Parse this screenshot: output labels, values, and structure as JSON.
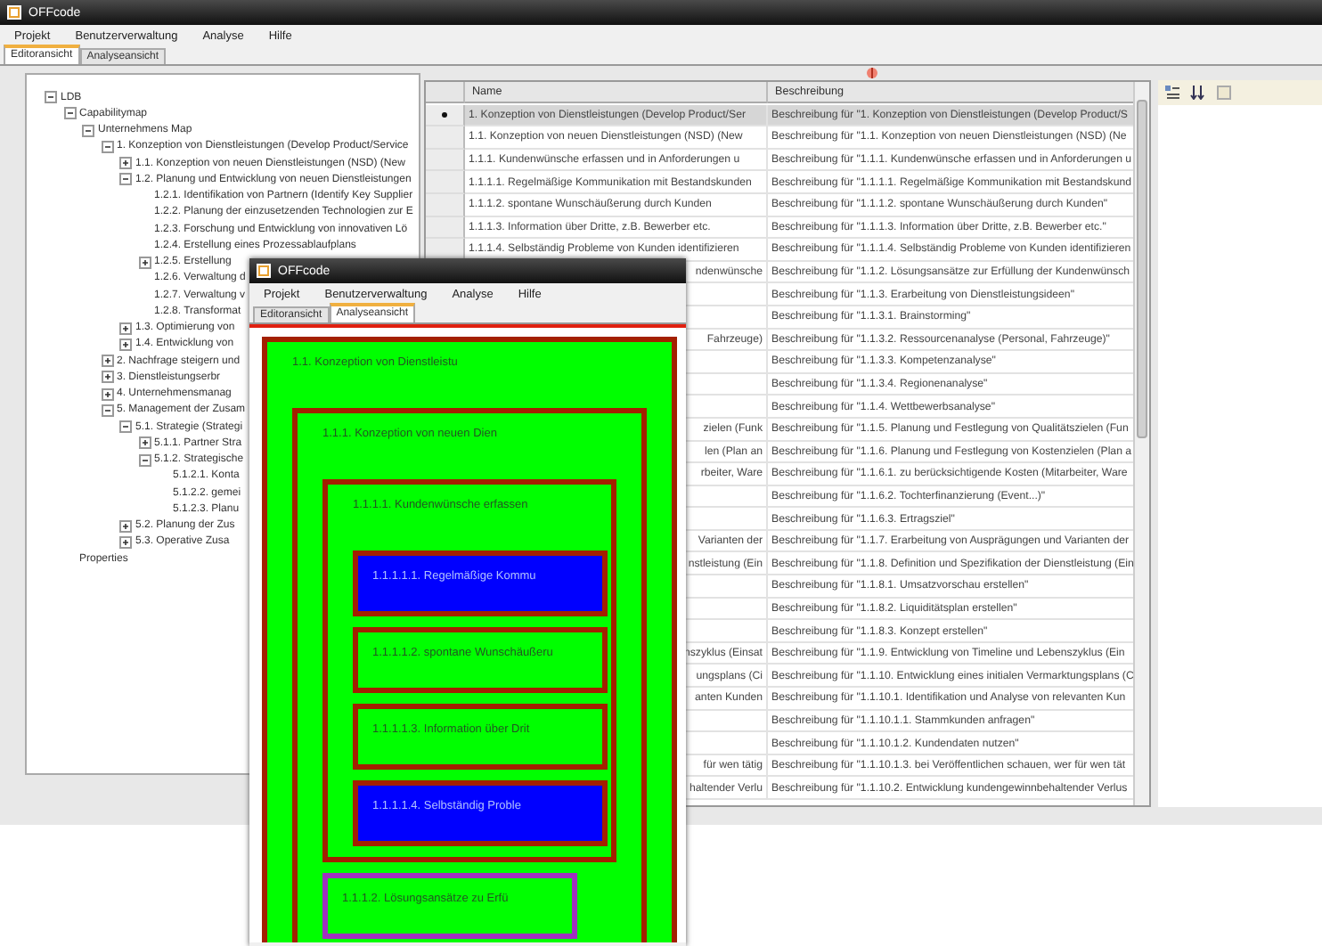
{
  "main_window": {
    "title": "OFFcode",
    "menu": [
      "Projekt",
      "Benutzerverwaltung",
      "Analyse",
      "Hilfe"
    ],
    "tabs": [
      {
        "label": "Editoransicht",
        "selected": true
      },
      {
        "label": "Analyseansicht",
        "selected": false
      }
    ],
    "tree": {
      "items": [
        {
          "label": "LDB",
          "expanded": true,
          "children": [
            {
              "label": "Capabilitymap",
              "expanded": true,
              "children": [
                {
                  "label": "Unternehmens Map",
                  "expanded": true,
                  "children": [
                    {
                      "label": "1. Konzeption von Dienstleistungen (Develop Product/Service",
                      "expanded": true,
                      "children": [
                        {
                          "label": "1.1. Konzeption von neuen Dienstleistungen (NSD) (New",
                          "expanded": false
                        },
                        {
                          "label": "1.2. Planung und Entwicklung von neuen Dienstleistungen",
                          "expanded": true,
                          "children": [
                            {
                              "label": "1.2.1. Identifikation von Partnern (Identify Key Supplier"
                            },
                            {
                              "label": "1.2.2. Planung der einzusetzenden Technologien zur E"
                            },
                            {
                              "label": "1.2.3. Forschung und Entwicklung von innovativen Lö"
                            },
                            {
                              "label": "1.2.4. Erstellung eines Prozessablaufplans"
                            },
                            {
                              "label": "1.2.5. Erstellung",
                              "expanded": false
                            },
                            {
                              "label": "1.2.6. Verwaltung d"
                            },
                            {
                              "label": "1.2.7. Verwaltung v"
                            },
                            {
                              "label": "1.2.8. Transformat"
                            }
                          ]
                        },
                        {
                          "label": "1.3. Optimierung von",
                          "expanded": false
                        },
                        {
                          "label": "1.4. Entwicklung von",
                          "expanded": false
                        }
                      ]
                    },
                    {
                      "label": "2. Nachfrage steigern und",
                      "expanded": false
                    },
                    {
                      "label": "3. Dienstleistungserbr",
                      "expanded": false
                    },
                    {
                      "label": "4. Unternehmensmanag",
                      "expanded": false
                    },
                    {
                      "label": "5. Management der Zusam",
                      "expanded": true,
                      "children": [
                        {
                          "label": "5.1. Strategie (Strategi",
                          "expanded": true,
                          "children": [
                            {
                              "label": "5.1.1. Partner Stra",
                              "expanded": false
                            },
                            {
                              "label": "5.1.2. Strategische",
                              "expanded": true,
                              "children": [
                                {
                                  "label": "5.1.2.1. Konta"
                                },
                                {
                                  "label": "5.1.2.2. gemei"
                                },
                                {
                                  "label": "5.1.2.3. Planu"
                                }
                              ]
                            }
                          ]
                        },
                        {
                          "label": "5.2. Planung der Zus",
                          "expanded": false
                        },
                        {
                          "label": "5.3. Operative Zusa",
                          "expanded": false
                        }
                      ]
                    }
                  ]
                }
              ]
            },
            {
              "label": "Properties"
            }
          ]
        }
      ]
    },
    "grid": {
      "columns": [
        "Name",
        "Beschreibung"
      ],
      "rows": [
        {
          "name": "1. Konzeption von Dienstleistungen (Develop Product/Ser",
          "description": "Beschreibung für \"1. Konzeption von Dienstleistungen (Develop Product/S",
          "selected": true
        },
        {
          "name": "1.1. Konzeption von neuen Dienstleistungen (NSD) (New",
          "description": "Beschreibung für \"1.1. Konzeption von neuen Dienstleistungen (NSD) (Ne",
          "selected": false
        },
        {
          "name": "1.1.1. Kundenwünsche erfassen und in Anforderungen u",
          "description": "Beschreibung für \"1.1.1. Kundenwünsche erfassen und in Anforderungen u",
          "selected": false
        },
        {
          "name": "1.1.1.1. Regelmäßige Kommunikation mit Bestandskunden",
          "description": "Beschreibung für \"1.1.1.1. Regelmäßige Kommunikation mit Bestandskund",
          "selected": false
        },
        {
          "name": "1.1.1.2. spontane Wunschäußerung durch Kunden",
          "description": "Beschreibung für \"1.1.1.2. spontane Wunschäußerung durch Kunden\"",
          "selected": false
        },
        {
          "name": "1.1.1.3. Information über Dritte, z.B. Bewerber etc.",
          "description": "Beschreibung für \"1.1.1.3. Information über Dritte, z.B. Bewerber etc.\"",
          "selected": false
        },
        {
          "name": "1.1.1.4. Selbständig Probleme von Kunden identifizieren",
          "description": "Beschreibung für \"1.1.1.4. Selbständig Probleme von Kunden identifizieren",
          "selected": false
        },
        {
          "name_tail": "ndenwünsche",
          "description": "Beschreibung für \"1.1.2. Lösungsansätze zur Erfüllung der Kundenwünsch",
          "selected": false
        },
        {
          "description": "Beschreibung für \"1.1.3. Erarbeitung von Dienstleistungsideen\"",
          "selected": false
        },
        {
          "description": "Beschreibung für \"1.1.3.1. Brainstorming\"",
          "selected": false
        },
        {
          "name_tail": "Fahrzeuge)",
          "description": "Beschreibung für \"1.1.3.2. Ressourcenanalyse (Personal, Fahrzeuge)\"",
          "selected": false
        },
        {
          "description": "Beschreibung für \"1.1.3.3. Kompetenzanalyse\"",
          "selected": false
        },
        {
          "description": "Beschreibung für \"1.1.3.4. Regionenanalyse\"",
          "selected": false
        },
        {
          "description": "Beschreibung für \"1.1.4. Wettbewerbsanalyse\"",
          "selected": false
        },
        {
          "name_tail": "zielen (Funk",
          "description": "Beschreibung für \"1.1.5. Planung und Festlegung von Qualitätszielen (Fun",
          "selected": false
        },
        {
          "name_tail": "len (Plan an",
          "description": "Beschreibung für \"1.1.6. Planung und Festlegung von Kostenzielen (Plan a",
          "selected": false
        },
        {
          "name_tail": "rbeiter, Ware",
          "description": "Beschreibung für \"1.1.6.1. zu berücksichtigende Kosten (Mitarbeiter, Ware",
          "selected": false
        },
        {
          "description": "Beschreibung für \"1.1.6.2. Tochterfinanzierung (Event...)\"",
          "selected": false
        },
        {
          "description": "Beschreibung für \"1.1.6.3. Ertragsziel\"",
          "selected": false
        },
        {
          "name_tail": "Varianten der",
          "description": "Beschreibung für \"1.1.7. Erarbeitung von Ausprägungen und Varianten der",
          "selected": false
        },
        {
          "name_tail": "nstleistung (Ein",
          "description": "Beschreibung für \"1.1.8. Definition und Spezifikation der Dienstleistung (Ein",
          "selected": false
        },
        {
          "description": "Beschreibung für \"1.1.8.1. Umsatzvorschau erstellen\"",
          "selected": false
        },
        {
          "description": "Beschreibung für \"1.1.8.2. Liquiditätsplan erstellen\"",
          "selected": false
        },
        {
          "description": "Beschreibung für \"1.1.8.3. Konzept erstellen\"",
          "selected": false
        },
        {
          "name_tail": "nszyklus (Einsat",
          "description": "Beschreibung für \"1.1.9. Entwicklung von Timeline und Lebenszyklus (Ein",
          "selected": false
        },
        {
          "name_tail": "ungsplans (Ci",
          "description": "Beschreibung für \"1.1.10. Entwicklung eines initialen Vermarktungsplans (C",
          "selected": false
        },
        {
          "name_tail": "anten Kunden",
          "description": "Beschreibung für \"1.1.10.1. Identifikation und Analyse von relevanten Kun",
          "selected": false
        },
        {
          "description": "Beschreibung für \"1.1.10.1.1. Stammkunden anfragen\"",
          "selected": false
        },
        {
          "description": "Beschreibung für \"1.1.10.1.2. Kundendaten nutzen\"",
          "selected": false
        },
        {
          "name_tail": "für wen tätig",
          "description": "Beschreibung für \"1.1.10.1.3. bei Veröffentlichen schauen, wer für wen tät",
          "selected": false
        },
        {
          "name_tail": "haltender Verlu",
          "description": "Beschreibung für \"1.1.10.2. Entwicklung kundengewinnbehaltender Verlus",
          "selected": false
        }
      ]
    }
  },
  "analysis_window": {
    "title": "OFFcode",
    "menu": [
      "Projekt",
      "Benutzerverwaltung",
      "Analyse",
      "Hilfe"
    ],
    "tabs": [
      {
        "label": "Editoransicht",
        "selected": false
      },
      {
        "label": "Analyseansicht",
        "selected": true
      }
    ],
    "canvas": {
      "boxes": [
        {
          "label": "1.1. Konzeption von Dienstleistu",
          "color": "#00ff00",
          "kind": "normal",
          "children": [
            {
              "label": "1.1.1. Konzeption von neuen Dien",
              "color": "#00ff00",
              "kind": "normal",
              "children": [
                {
                  "label": "1.1.1.1. Kundenwünsche erfassen",
                  "color": "#00ff00",
                  "kind": "normal",
                  "children": [
                    {
                      "label": "1.1.1.1.1. Regelmäßige Kommu",
                      "color": "#0000ff",
                      "kind": "normal"
                    },
                    {
                      "label": "1.1.1.1.2. spontane Wunschäußeru",
                      "color": "#00ff00",
                      "kind": "normal"
                    },
                    {
                      "label": "1.1.1.1.3. Information über Drit",
                      "color": "#00ff00",
                      "kind": "normal"
                    },
                    {
                      "label": "1.1.1.1.4. Selbständig Proble",
                      "color": "#0000ff",
                      "kind": "normal"
                    }
                  ]
                },
                {
                  "label": "1.1.1.2. Lösungsansätze zu Erfü",
                  "color": "#00ff00",
                  "kind": "highlighted"
                }
              ]
            }
          ]
        }
      ]
    }
  }
}
